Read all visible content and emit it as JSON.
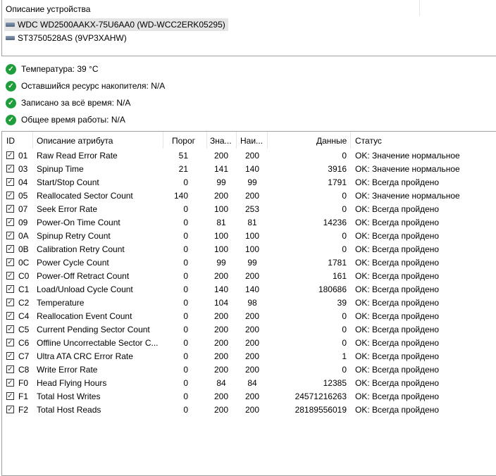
{
  "devices": {
    "header": "Описание устройства",
    "items": [
      {
        "label": "WDC WD2500AAKX-75U6AA0 (WD-WCC2ERK05295)",
        "selected": true
      },
      {
        "label": "ST3750528AS (9VP3XAHW)",
        "selected": false
      }
    ]
  },
  "status": [
    {
      "icon": "check-circle-icon",
      "label": "Температура: 39 °C"
    },
    {
      "icon": "check-circle-icon",
      "label": "Оставшийся ресурс накопителя: N/A"
    },
    {
      "icon": "check-circle-icon",
      "label": "Записано за всё время: N/A"
    },
    {
      "icon": "check-circle-icon",
      "label": "Общее время работы: N/A"
    }
  ],
  "colors": {
    "ok": "#1f9d3a",
    "selection": "#e5e5e5"
  },
  "table": {
    "columns": [
      "ID",
      "Описание атрибута",
      "Порог",
      "Зна...",
      "Наи...",
      "Данные",
      "Статус"
    ],
    "rows": [
      [
        "01",
        "Raw Read Error Rate",
        "51",
        "200",
        "200",
        "0",
        "OK: Значение нормальное"
      ],
      [
        "03",
        "Spinup Time",
        "21",
        "141",
        "140",
        "3916",
        "OK: Значение нормальное"
      ],
      [
        "04",
        "Start/Stop Count",
        "0",
        "99",
        "99",
        "1791",
        "OK: Всегда пройдено"
      ],
      [
        "05",
        "Reallocated Sector Count",
        "140",
        "200",
        "200",
        "0",
        "OK: Значение нормальное"
      ],
      [
        "07",
        "Seek Error Rate",
        "0",
        "100",
        "253",
        "0",
        "OK: Всегда пройдено"
      ],
      [
        "09",
        "Power-On Time Count",
        "0",
        "81",
        "81",
        "14236",
        "OK: Всегда пройдено"
      ],
      [
        "0A",
        "Spinup Retry Count",
        "0",
        "100",
        "100",
        "0",
        "OK: Всегда пройдено"
      ],
      [
        "0B",
        "Calibration Retry Count",
        "0",
        "100",
        "100",
        "0",
        "OK: Всегда пройдено"
      ],
      [
        "0C",
        "Power Cycle Count",
        "0",
        "99",
        "99",
        "1781",
        "OK: Всегда пройдено"
      ],
      [
        "C0",
        "Power-Off Retract Count",
        "0",
        "200",
        "200",
        "161",
        "OK: Всегда пройдено"
      ],
      [
        "C1",
        "Load/Unload Cycle Count",
        "0",
        "140",
        "140",
        "180686",
        "OK: Всегда пройдено"
      ],
      [
        "C2",
        "Temperature",
        "0",
        "104",
        "98",
        "39",
        "OK: Всегда пройдено"
      ],
      [
        "C4",
        "Reallocation Event Count",
        "0",
        "200",
        "200",
        "0",
        "OK: Всегда пройдено"
      ],
      [
        "C5",
        "Current Pending Sector Count",
        "0",
        "200",
        "200",
        "0",
        "OK: Всегда пройдено"
      ],
      [
        "C6",
        "Offline Uncorrectable Sector C...",
        "0",
        "200",
        "200",
        "0",
        "OK: Всегда пройдено"
      ],
      [
        "C7",
        "Ultra ATA CRC Error Rate",
        "0",
        "200",
        "200",
        "1",
        "OK: Всегда пройдено"
      ],
      [
        "C8",
        "Write Error Rate",
        "0",
        "200",
        "200",
        "0",
        "OK: Всегда пройдено"
      ],
      [
        "F0",
        "Head Flying Hours",
        "0",
        "84",
        "84",
        "12385",
        "OK: Всегда пройдено"
      ],
      [
        "F1",
        "Total Host Writes",
        "0",
        "200",
        "200",
        "24571216263",
        "OK: Всегда пройдено"
      ],
      [
        "F2",
        "Total Host Reads",
        "0",
        "200",
        "200",
        "28189556019",
        "OK: Всегда пройдено"
      ]
    ]
  }
}
